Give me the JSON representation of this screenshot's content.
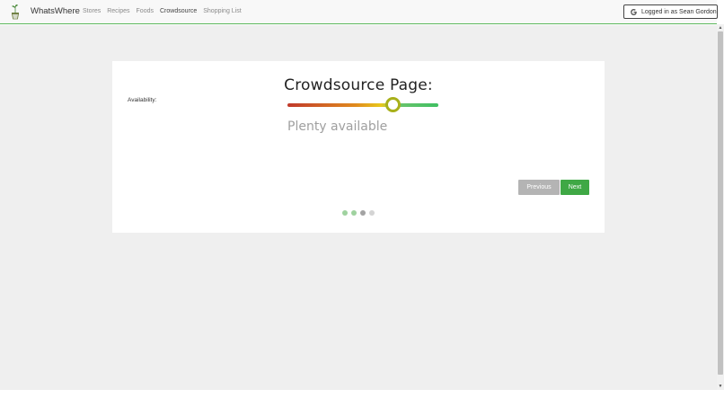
{
  "navbar": {
    "logo_icon": "sprout-in-pot-icon",
    "brand": "WhatsWhere",
    "links": [
      {
        "label": "Stores",
        "active": false
      },
      {
        "label": "Recipes",
        "active": false
      },
      {
        "label": "Foods",
        "active": false
      },
      {
        "label": "Crowdsource",
        "active": true
      },
      {
        "label": "Shopping List",
        "active": false
      }
    ],
    "login": {
      "icon": "google-icon",
      "label": "Logged in as Sean Gordon"
    }
  },
  "card": {
    "title": "Crowdsource Page:",
    "field_label": "Availability:",
    "slider": {
      "value_fraction": 0.7,
      "colors": [
        "#c0392b",
        "#e08a1e",
        "#e8c81c",
        "#3fbf62"
      ]
    },
    "value_text": "Plenty available",
    "buttons": {
      "previous": "Previous",
      "next": "Next"
    },
    "steps": {
      "total": 4,
      "current": 3
    }
  },
  "colors": {
    "accent": "#3fa845",
    "navbar_border": "#5cb85c",
    "disabled_button": "#b4b4b4"
  }
}
